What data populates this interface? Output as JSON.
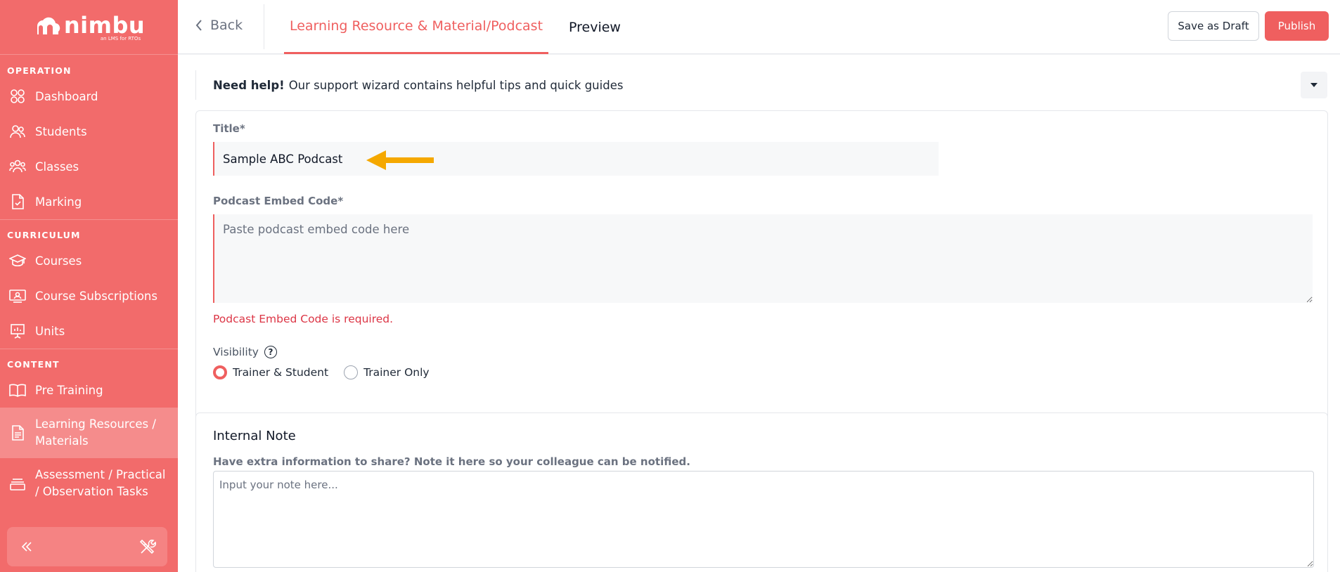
{
  "sidebar": {
    "logo_text": "nimbu",
    "logo_sub": "an LMS for RTOs",
    "sections": {
      "operation": "OPERATION",
      "curriculum": "CURRICULUM",
      "content": "CONTENT"
    },
    "items": {
      "dashboard": "Dashboard",
      "students": "Students",
      "classes": "Classes",
      "marking": "Marking",
      "courses": "Courses",
      "course_subscriptions": "Course Subscriptions",
      "units": "Units",
      "pre_training": "Pre Training",
      "learning_resources": "Learning Resources / Materials",
      "assessment": "Assessment / Practical / Observation Tasks"
    }
  },
  "topbar": {
    "back_label": "Back",
    "tab_active": "Learning Resource & Material/Podcast",
    "tab_preview": "Preview",
    "save_draft": "Save as Draft",
    "publish": "Publish"
  },
  "help": {
    "bold": "Need help!",
    "text": "Our support wizard contains helpful tips and quick guides"
  },
  "form": {
    "title_label": "Title*",
    "title_value": "Sample ABC Podcast",
    "embed_label": "Podcast Embed Code*",
    "embed_placeholder": "Paste podcast embed code here",
    "embed_error": "Podcast Embed Code is required.",
    "visibility_label": "Visibility",
    "visibility_options": [
      "Trainer & Student",
      "Trainer Only"
    ],
    "visibility_selected": "Trainer & Student"
  },
  "note": {
    "title": "Internal Note",
    "subtitle": "Have extra information to share? Note it here so your colleague can be notified.",
    "placeholder": "Input your note here..."
  },
  "colors": {
    "brand": "#f26b6b",
    "accent": "#ef5f5f",
    "error": "#dc3545",
    "arrow": "#f5a800"
  }
}
